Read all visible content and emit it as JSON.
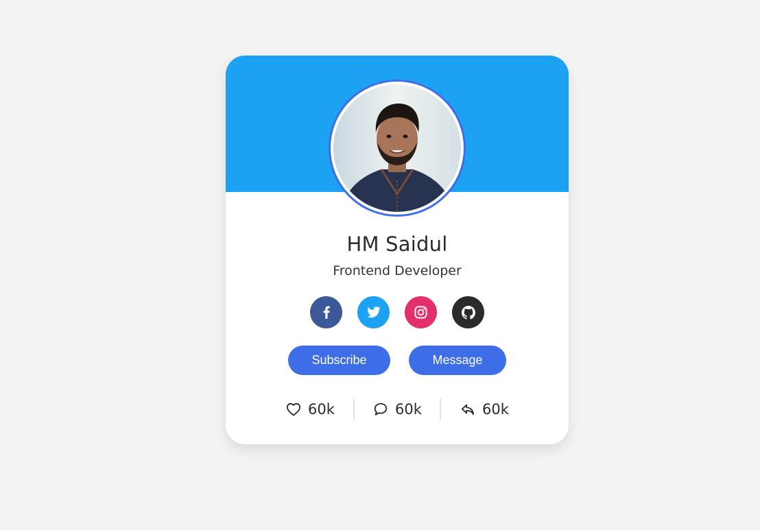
{
  "profile": {
    "name": "HM Saidul",
    "role": "Frontend Developer"
  },
  "socials": [
    {
      "name": "facebook",
      "icon": "facebook-icon",
      "color": "#3b5998"
    },
    {
      "name": "twitter",
      "icon": "twitter-icon",
      "color": "#1da1f2"
    },
    {
      "name": "instagram",
      "icon": "instagram-icon",
      "color": "#e1306c"
    },
    {
      "name": "github",
      "icon": "github-icon",
      "color": "#2b2b2b"
    }
  ],
  "buttons": {
    "subscribe": "Subscribe",
    "message": "Message"
  },
  "stats": {
    "likes": "60k",
    "comments": "60k",
    "shares": "60k"
  },
  "colors": {
    "banner": "#1da1f2",
    "accent": "#3d6ee8",
    "background": "#f3f3f3"
  }
}
